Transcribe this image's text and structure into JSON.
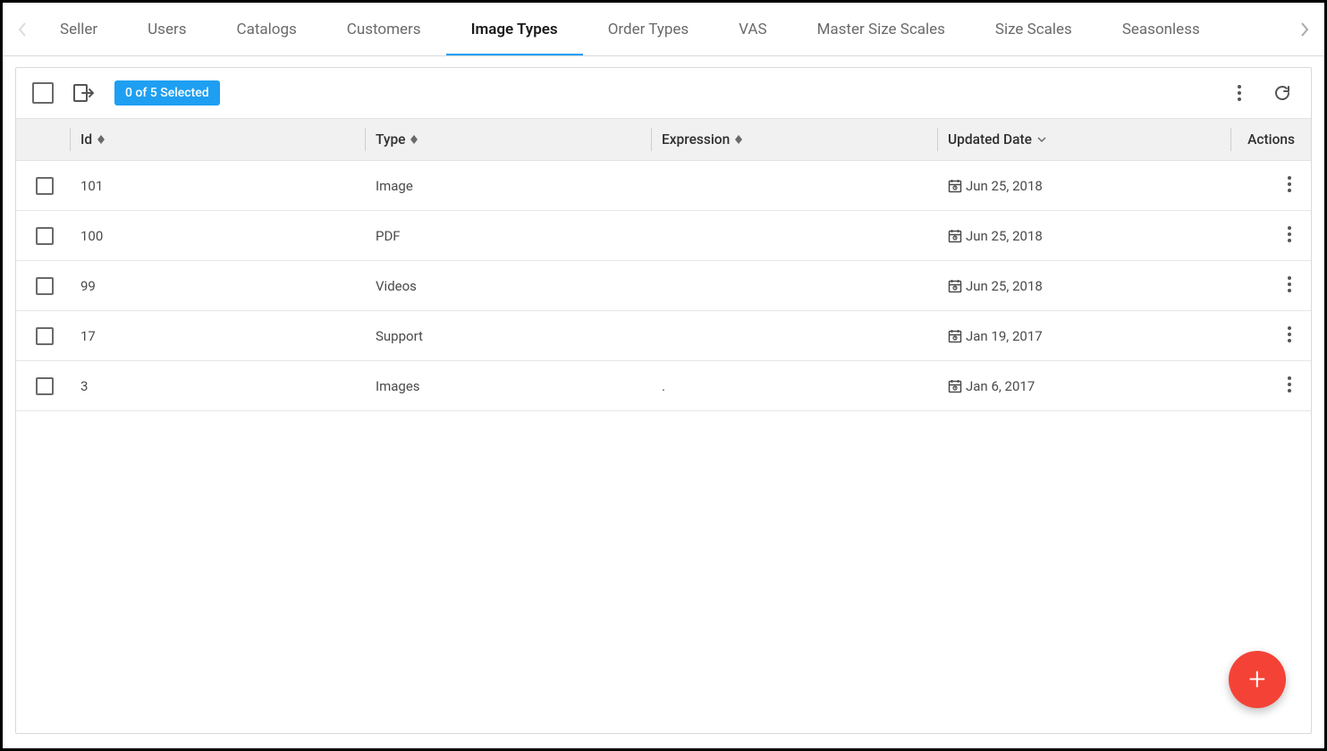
{
  "tabs": {
    "items": [
      {
        "label": "Seller"
      },
      {
        "label": "Users"
      },
      {
        "label": "Catalogs"
      },
      {
        "label": "Customers"
      },
      {
        "label": "Image Types",
        "active": true
      },
      {
        "label": "Order Types"
      },
      {
        "label": "VAS"
      },
      {
        "label": "Master Size Scales"
      },
      {
        "label": "Size Scales"
      },
      {
        "label": "Seasonless"
      }
    ]
  },
  "toolbar": {
    "selection_badge": "0 of 5 Selected"
  },
  "columns": {
    "id": "Id",
    "type": "Type",
    "expression": "Expression",
    "updated": "Updated Date",
    "actions": "Actions"
  },
  "rows": [
    {
      "id": "101",
      "type": "Image",
      "expression": "",
      "updated": "Jun 25, 2018"
    },
    {
      "id": "100",
      "type": "PDF",
      "expression": "",
      "updated": "Jun 25, 2018"
    },
    {
      "id": "99",
      "type": "Videos",
      "expression": "",
      "updated": "Jun 25, 2018"
    },
    {
      "id": "17",
      "type": "Support",
      "expression": "",
      "updated": "Jan 19, 2017"
    },
    {
      "id": "3",
      "type": "Images",
      "expression": ".",
      "updated": "Jan 6, 2017"
    }
  ],
  "fab": {
    "glyph": "+"
  }
}
